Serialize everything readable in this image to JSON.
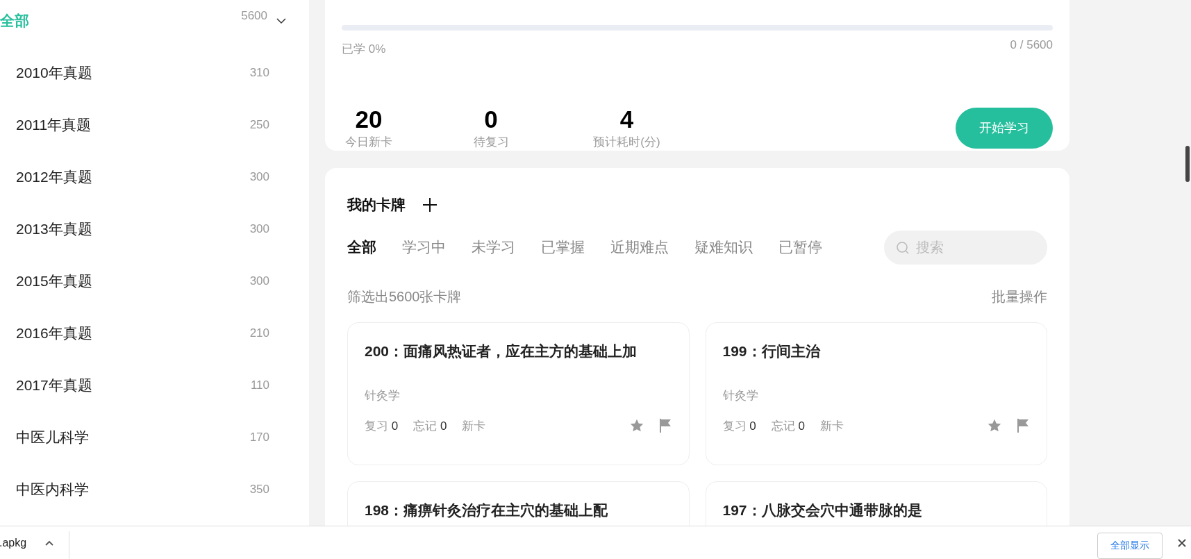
{
  "sidebar": {
    "root": {
      "label": "全部",
      "count": "5600",
      "selected": true,
      "expanded": true
    },
    "items": [
      {
        "label": "2010年真题",
        "count": "310",
        "selected": false
      },
      {
        "label": "2011年真题",
        "count": "250",
        "selected": false
      },
      {
        "label": "2012年真题",
        "count": "300",
        "selected": false
      },
      {
        "label": "2013年真题",
        "count": "300",
        "selected": false
      },
      {
        "label": "2015年真题",
        "count": "300",
        "selected": false
      },
      {
        "label": "2016年真题",
        "count": "210",
        "selected": false
      },
      {
        "label": "2017年真题",
        "count": "110",
        "selected": false
      },
      {
        "label": "中医儿科学",
        "count": "170",
        "selected": false
      },
      {
        "label": "中医内科学",
        "count": "350",
        "selected": false
      }
    ]
  },
  "overview": {
    "progress": {
      "level": 0,
      "label": "已学 0%",
      "reading": "0 / 5600"
    },
    "stats": [
      {
        "value": "20",
        "label": "今日新卡"
      },
      {
        "value": "0",
        "label": "待复习"
      },
      {
        "value": "4",
        "label": "预计耗时(分)"
      }
    ],
    "start_button": "开始学习"
  },
  "deck": {
    "title": "我的卡牌",
    "tabs": [
      {
        "label": "全部",
        "selected": true
      },
      {
        "label": "学习中",
        "selected": false
      },
      {
        "label": "未学习",
        "selected": false
      },
      {
        "label": "已掌握",
        "selected": false
      },
      {
        "label": "近期难点",
        "selected": false
      },
      {
        "label": "疑难知识",
        "selected": false
      },
      {
        "label": "已暂停",
        "selected": false
      }
    ],
    "search": {
      "placeholder": "搜索"
    },
    "filter_text": "筛选出5600张卡牌",
    "batch": "批量操作",
    "cards": [
      {
        "title": "200：面痛风热证者，应在主方的基础上加",
        "subject": "针灸学",
        "review_label": "复习",
        "review_count": "0",
        "forget_label": "忘记",
        "forget_count": "0",
        "status": "新卡"
      },
      {
        "title": "199：行间主治",
        "subject": "针灸学",
        "review_label": "复习",
        "review_count": "0",
        "forget_label": "忘记",
        "forget_count": "0",
        "status": "新卡"
      },
      {
        "title": "198：痛痹针灸治疗在主穴的基础上配"
      },
      {
        "title": "197：八脉交会穴中通带脉的是"
      }
    ]
  },
  "download_bar": {
    "file": ".apkg",
    "show_all": "全部显示"
  }
}
